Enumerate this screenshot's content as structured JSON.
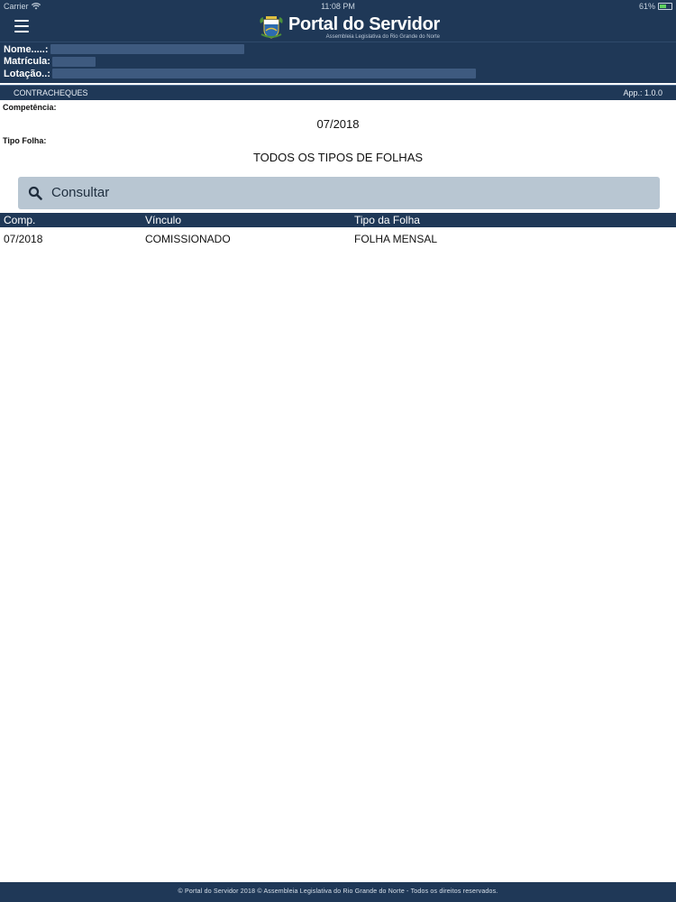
{
  "status": {
    "carrier": "Carrier",
    "time": "11:08 PM",
    "battery": "61%",
    "battery_level": 0.61
  },
  "header": {
    "title": "Portal do Servidor",
    "subtitle": "Assembleia Legislativa do Rio Grande do Norte"
  },
  "user": {
    "name_label": "Nome.....:",
    "registration_label": "Matrícula:",
    "location_label": "Lotação..:"
  },
  "section": {
    "title": "CONTRACHEQUES",
    "version": "App.: 1.0.0"
  },
  "form": {
    "competencia_label": "Competência:",
    "competencia_value": "07/2018",
    "tipo_folha_label": "Tipo Folha:",
    "tipo_folha_value": "TODOS OS TIPOS DE FOLHAS"
  },
  "search": {
    "label": "Consultar"
  },
  "table": {
    "headers": [
      "Comp.",
      "Vínculo",
      "Tipo da Folha"
    ],
    "rows": [
      [
        "07/2018",
        "COMISSIONADO",
        "FOLHA MENSAL"
      ]
    ]
  },
  "footer": {
    "text": "© Portal do Servidor 2018 © Assembleia Legislativa do Rio Grande do Norte - Todos os direitos reservados."
  },
  "colors": {
    "primary": "#1f3857",
    "button": "#b8c6d2",
    "battery": "#5ed05e"
  }
}
